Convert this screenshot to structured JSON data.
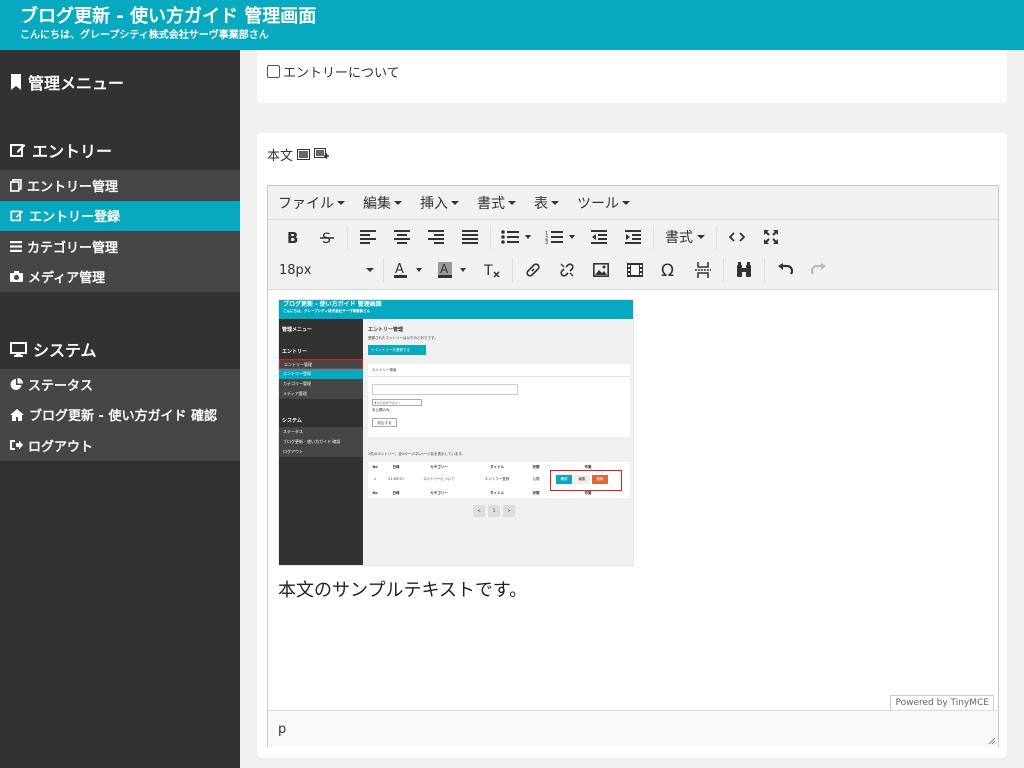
{
  "header": {
    "title": "ブログ更新 - 使い方ガイド 管理画面",
    "subtitle": "こんにちは、グレープシティ株式会社サーヴ事業部さん"
  },
  "sidebar": {
    "menu_heading": "管理メニュー",
    "entry_heading": "エントリー",
    "entry_items": [
      {
        "label": "エントリー管理",
        "icon": "copy-icon"
      },
      {
        "label": "エントリー登録",
        "icon": "edit-icon",
        "active": true
      },
      {
        "label": "カテゴリー管理",
        "icon": "list-icon"
      },
      {
        "label": "メディア管理",
        "icon": "camera-icon"
      }
    ],
    "system_heading": "システム",
    "system_items": [
      {
        "label": "ステータス",
        "icon": "pie-chart-icon"
      },
      {
        "label": "ブログ更新 - 使い方ガイド 確認",
        "icon": "home-icon"
      },
      {
        "label": "ログアウト",
        "icon": "sign-out-icon"
      }
    ]
  },
  "main": {
    "about_entry_label": "エントリーについて",
    "body_label": "本文"
  },
  "editor": {
    "menus": [
      "ファイル",
      "編集",
      "挿入",
      "書式",
      "表",
      "ツール"
    ],
    "style_label": "書式",
    "font_size": "18px",
    "sample_text": "本文のサンプルテキストです。",
    "powered_by": "Powered by TinyMCE",
    "status_path": "p"
  },
  "embedded": {
    "title": "ブログ更新 - 使い方ガイド 管理画面",
    "subtitle": "こんにちは、グレープシティ株式会社サーヴ事業部さん",
    "menu_heading": "管理メニュー",
    "entry_heading": "エントリー",
    "entry_items": [
      "エントリー管理",
      "エントリー登録",
      "カテゴリー管理",
      "メディア管理"
    ],
    "system_heading": "システム",
    "system_items": [
      "ステータス",
      "ブログ更新 - 使い方ガイド 確認",
      "ログアウト"
    ],
    "page_title": "エントリー管理",
    "intro": "登録されたエントリーは以下のとおりです。",
    "register_button": "➔ エントリーを登録する",
    "search_heading": "エントリー検索",
    "category_select": "すべてのカテゴリー",
    "unpublished_label": "未公開のみ",
    "filter_button": "絞込する",
    "count_text": "2件のエントリー。全3ページ中1ページ目を表示しています。",
    "table_headers": [
      "No",
      "日時",
      "カテゴリー",
      "タイトル",
      "状態",
      "作業"
    ],
    "row": [
      "1",
      "21:09:57",
      "エントリーについて",
      "エントリー登録",
      "公開"
    ],
    "actions": [
      "確認",
      "編集",
      "削除"
    ],
    "pagination": [
      "<",
      "1",
      ">"
    ]
  },
  "colors": {
    "accent": "#06a9bf",
    "sidebar_bg": "#323232",
    "sidebar_group_bg": "#464646",
    "highlight_red": "#e02020"
  }
}
